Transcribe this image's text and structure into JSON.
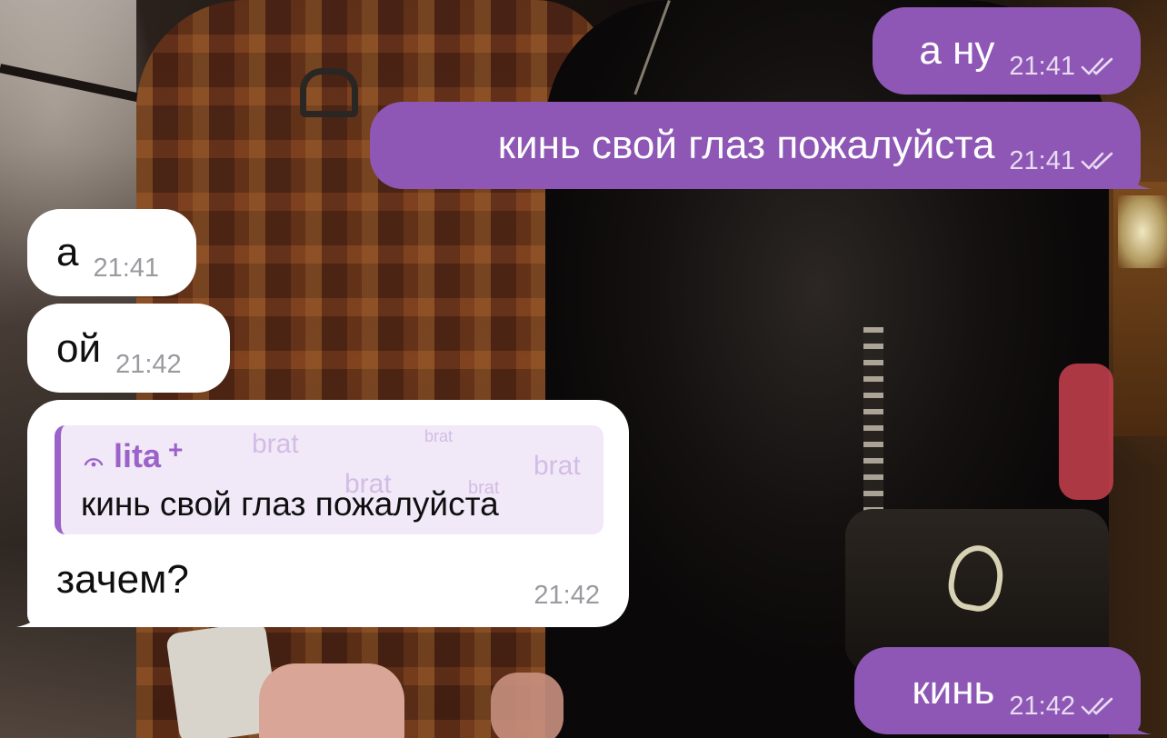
{
  "colors": {
    "outgoing_bubble": "#8e57b5",
    "incoming_bubble": "#ffffff",
    "reply_accent": "#9b62c9",
    "reply_background": "#f1e9f7"
  },
  "messages": [
    {
      "direction": "outgoing",
      "text": "а ну",
      "time": "21:41",
      "status_icon": "double-check-icon"
    },
    {
      "direction": "outgoing",
      "text": "кинь свой глаз пожалуйста",
      "time": "21:41",
      "status_icon": "double-check-icon"
    },
    {
      "direction": "incoming",
      "text": "а",
      "time": "21:41"
    },
    {
      "direction": "incoming",
      "text": "ой",
      "time": "21:42"
    },
    {
      "direction": "incoming",
      "reply": {
        "author": "lita",
        "author_icon": "signal-arc-icon",
        "author_badge": "+",
        "text": "кинь свой глаз пожалуйста",
        "watermark": "brat"
      },
      "text": "зачем?",
      "time": "21:42"
    },
    {
      "direction": "outgoing",
      "text": "кинь",
      "time": "21:42",
      "status_icon": "double-check-icon"
    }
  ]
}
